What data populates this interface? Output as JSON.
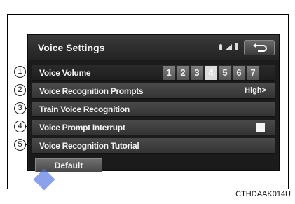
{
  "screen": {
    "title": "Voice Settings",
    "status_icons": [
      "bluetooth-icon",
      "signal-icon",
      "battery-icon"
    ],
    "back_icon": "back-arrow-icon"
  },
  "rows": [
    {
      "label": "Voice Volume",
      "callout": "1"
    },
    {
      "label": "Voice Recognition Prompts",
      "value": "High>",
      "callout": "2"
    },
    {
      "label": "Train Voice Recognition",
      "callout": "3"
    },
    {
      "label": "Voice Prompt Interrupt",
      "callout": "4",
      "checkbox_checked": true
    },
    {
      "label": "Voice Recognition Tutorial",
      "callout": "5"
    }
  ],
  "volume": {
    "levels": [
      "1",
      "2",
      "3",
      "4",
      "5",
      "6",
      "7"
    ],
    "selected": "4"
  },
  "default_button": "Default",
  "caption": "CTHDAAK014U",
  "colors": {
    "screen_bg": "#1b1b1b",
    "row_bg": "#3e3e3e",
    "text": "#f2f2f2",
    "selected_level": "#dcdcdc",
    "cursor": "#4f6fe0"
  }
}
